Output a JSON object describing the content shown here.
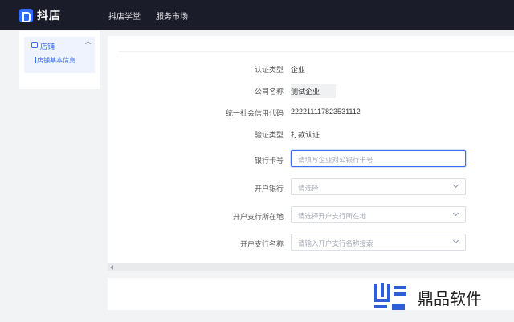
{
  "header": {
    "logo_text": "抖店",
    "nav": [
      "抖店学堂",
      "服务市场"
    ]
  },
  "sidebar": {
    "group_label": "店铺",
    "item_label": "店铺基本信息"
  },
  "form": {
    "auth_type_label": "认证类型",
    "auth_type_value": "企业",
    "company_label": "公司名称",
    "company_value": "测试企业",
    "credit_code_label": "统一社会信用代码",
    "credit_code_value": "222211117823531112",
    "verify_type_label": "验证类型",
    "verify_type_value": "打款认证",
    "bank_card_label": "银行卡号",
    "bank_card_placeholder": "请填写企业对公银行卡号",
    "bank_label": "开户银行",
    "bank_placeholder": "请选择",
    "branch_loc_label": "开户支行所在地",
    "branch_loc_placeholder": "请选择开户支行所在地",
    "branch_name_label": "开户支行名称",
    "branch_name_placeholder": "请输入开户支行名称搜索"
  },
  "watermark": {
    "text": "鼎品软件"
  },
  "colors": {
    "topbar": "#1a1d29",
    "accent": "#3a6df0"
  }
}
